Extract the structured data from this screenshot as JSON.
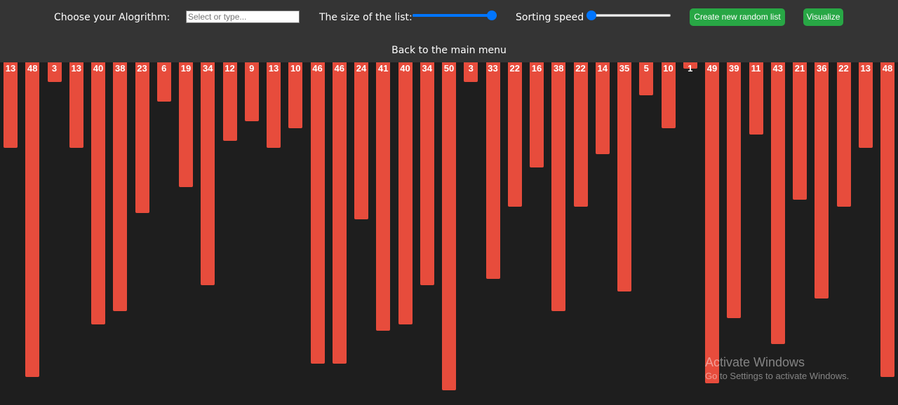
{
  "toolbar": {
    "algorithm_label": "Choose your Alogrithm:",
    "algorithm_placeholder": "Select or type...",
    "size_label": "The size of the list:",
    "size_slider_fraction": 1.0,
    "speed_label": "Sorting speed",
    "speed_slider_fraction": 0.0,
    "new_list_button": "Create new random list",
    "visualize_button": "Visualize",
    "back_link": "Back to the main menu"
  },
  "colors": {
    "bar": "#e74c3c",
    "button": "#28a745",
    "slider": "#0075ff",
    "toolbar_bg": "#343434",
    "canvas_bg": "#1e1e1e"
  },
  "bars": [
    13,
    48,
    3,
    13,
    40,
    38,
    23,
    6,
    19,
    34,
    12,
    9,
    13,
    10,
    46,
    46,
    24,
    41,
    40,
    34,
    50,
    3,
    33,
    22,
    16,
    38,
    22,
    14,
    35,
    5,
    10,
    1,
    49,
    39,
    11,
    43,
    21,
    36,
    22,
    13,
    48
  ],
  "watermark": {
    "title": "Activate Windows",
    "subtitle": "Go to Settings to activate Windows."
  }
}
